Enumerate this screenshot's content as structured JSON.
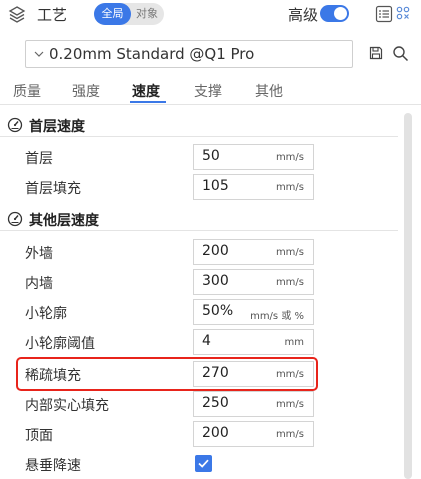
{
  "header": {
    "title": "工艺",
    "icon": "layers-icon",
    "scope_segment": {
      "global_label": "全局",
      "object_label": "对象",
      "selected": "全局"
    },
    "advanced_label": "高级",
    "advanced_toggle_on": true
  },
  "preset": {
    "value": "0.20mm Standard @Q1 Pro"
  },
  "tabs": [
    {
      "label": "质量",
      "active": false
    },
    {
      "label": "强度",
      "active": false
    },
    {
      "label": "速度",
      "active": true
    },
    {
      "label": "支撑",
      "active": false
    },
    {
      "label": "其他",
      "active": false
    }
  ],
  "sections": {
    "first_layer": {
      "title": "首层速度",
      "icon": "speedometer-icon",
      "rows": [
        {
          "label": "首层",
          "value": "50",
          "unit": "mm/s"
        },
        {
          "label": "首层填充",
          "value": "105",
          "unit": "mm/s"
        }
      ]
    },
    "other_layers": {
      "title": "其他层速度",
      "icon": "speedometer-icon",
      "rows": [
        {
          "label": "外墙",
          "value": "200",
          "unit": "mm/s"
        },
        {
          "label": "内墙",
          "value": "300",
          "unit": "mm/s"
        },
        {
          "label": "小轮廓",
          "value": "50%",
          "unit": "mm/s 或 %"
        },
        {
          "label": "小轮廓阈值",
          "value": "4",
          "unit": "mm"
        },
        {
          "label": "稀疏填充",
          "value": "270",
          "unit": "mm/s"
        },
        {
          "label": "内部实心填充",
          "value": "250",
          "unit": "mm/s"
        },
        {
          "label": "顶面",
          "value": "200",
          "unit": "mm/s"
        }
      ],
      "checkbox_row": {
        "label": "悬垂降速",
        "checked": true
      }
    }
  },
  "colors": {
    "accent": "#3b78e7",
    "highlight": "#e8241b"
  }
}
